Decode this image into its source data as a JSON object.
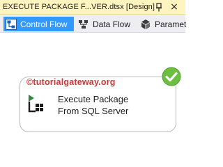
{
  "document_tab": {
    "title": "EXECUTE PACKAGE F...VER.dtsx [Design]",
    "pin_icon": "pin-icon",
    "close_icon": "close-icon",
    "close_glyph": "×"
  },
  "designer_tabs": [
    {
      "label": "Control Flow",
      "icon": "control-flow-icon",
      "active": true
    },
    {
      "label": "Data Flow",
      "icon": "data-flow-icon",
      "active": false
    },
    {
      "label": "Paramet",
      "icon": "parameters-icon",
      "active": false
    }
  ],
  "canvas": {
    "watermark": "©tutorialgateway.org",
    "task": {
      "label": "Execute Package\nFrom SQL Server",
      "icon": "execute-package-task-icon",
      "status": "success-check-icon"
    }
  },
  "colors": {
    "doc_tab_bg": "#fdf4bf",
    "active_tab_bg": "#3399ff",
    "tabs_bar_bg": "#eeeef2",
    "success_green": "#6cbf3f",
    "watermark_red": "#d13438"
  }
}
